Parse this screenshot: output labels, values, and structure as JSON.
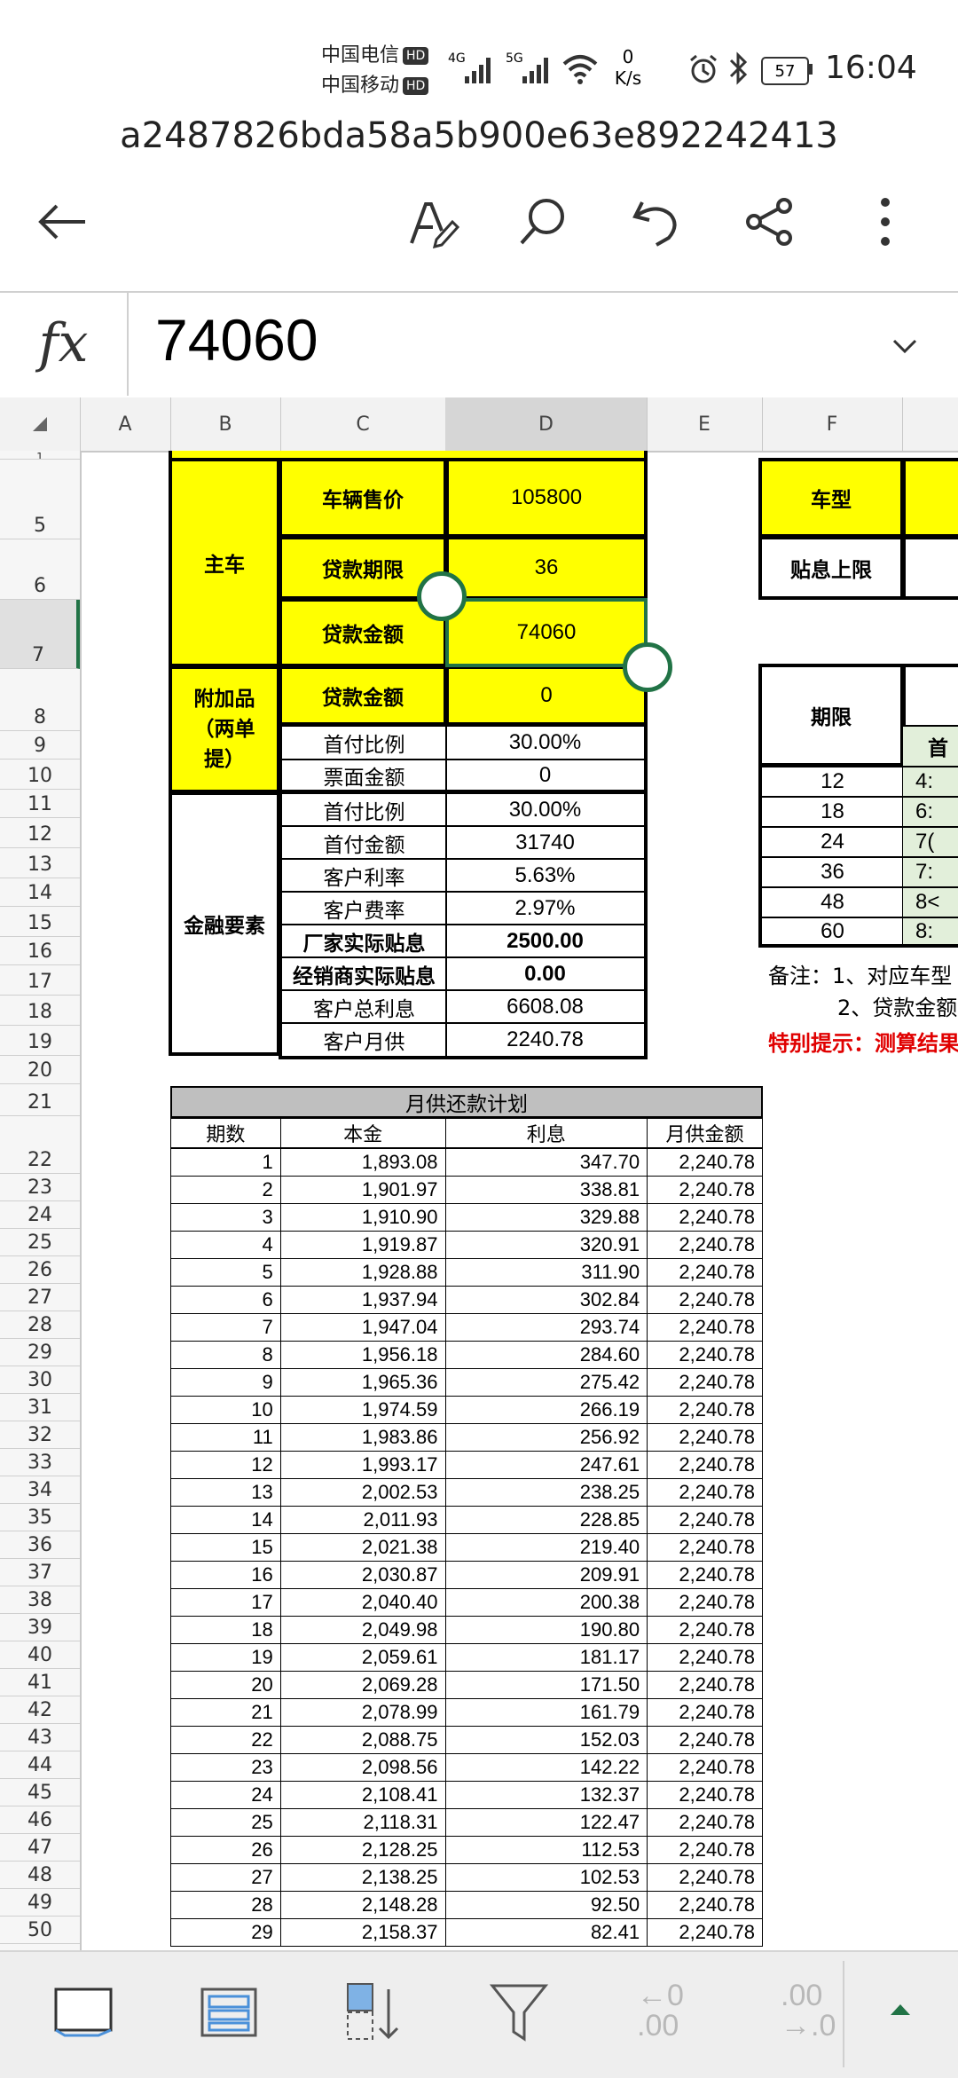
{
  "status_bar": {
    "carrier1": "中国电信",
    "carrier2": "中国移动",
    "hd": "HD",
    "net1": "4G",
    "net2": "5G",
    "speed_value": "0",
    "speed_unit": "K/s",
    "battery": "57",
    "time": "16:04"
  },
  "document_title": "a2487826bda58a5b900e63e892242413",
  "formula_bar": {
    "fx_label": "fx",
    "value": "74060"
  },
  "columns": [
    "A",
    "B",
    "C",
    "D",
    "E",
    "F"
  ],
  "rows": [
    "1",
    "5",
    "6",
    "7",
    "8",
    "9",
    "10",
    "11",
    "12",
    "13",
    "14",
    "15",
    "16",
    "17",
    "18",
    "19",
    "20",
    "21",
    "22",
    "23",
    "24",
    "25",
    "26",
    "27",
    "28",
    "29",
    "30",
    "31",
    "32",
    "33",
    "34",
    "35",
    "36",
    "37",
    "38",
    "39",
    "40",
    "41",
    "42",
    "43",
    "44",
    "45",
    "46",
    "47",
    "48",
    "49",
    "50"
  ],
  "main_table": {
    "main_car_label": "主车",
    "vehicle_price_label": "车辆售价",
    "vehicle_price": "105800",
    "loan_term_label": "贷款期限",
    "loan_term": "36",
    "loan_amount_label": "贷款金额",
    "loan_amount": "74060",
    "addon_label": "附加品（两单提）",
    "addon_loan_label": "贷款金额",
    "addon_loan": "0",
    "addon_down_label": "首付比例",
    "addon_down": "30.00%",
    "addon_ticket_label": "票面金额",
    "addon_ticket": "0",
    "finance_label": "金融要素",
    "down_ratio_label": "首付比例",
    "down_ratio": "30.00%",
    "down_amount_label": "首付金额",
    "down_amount": "31740",
    "rate_label": "客户利率",
    "rate": "5.63%",
    "fee_label": "客户费率",
    "fee": "2.97%",
    "mfr_subsidy_label": "厂家实际贴息",
    "mfr_subsidy": "2500.00",
    "dealer_subsidy_label": "经销商实际贴息",
    "dealer_subsidy": "0.00",
    "total_interest_label": "客户总利息",
    "total_interest": "6608.08",
    "monthly_label": "客户月供",
    "monthly": "2240.78"
  },
  "side_table": {
    "car_model_label": "车型",
    "subsidy_cap_label": "贴息上限",
    "term_label": "期限",
    "first_header_partial": "首",
    "terms": [
      "12",
      "18",
      "24",
      "36",
      "48",
      "60"
    ],
    "partial_values": [
      "4:",
      "6:",
      "7(",
      "7:",
      "8<",
      "8:"
    ],
    "note1": "备注：1、对应车型",
    "note2": "2、贷款金额",
    "special_note": "特别提示：测算结果"
  },
  "schedule": {
    "title": "月供还款计划",
    "headers": [
      "期数",
      "本金",
      "利息",
      "月供金额"
    ],
    "rows": [
      [
        "1",
        "1,893.08",
        "347.70",
        "2,240.78"
      ],
      [
        "2",
        "1,901.97",
        "338.81",
        "2,240.78"
      ],
      [
        "3",
        "1,910.90",
        "329.88",
        "2,240.78"
      ],
      [
        "4",
        "1,919.87",
        "320.91",
        "2,240.78"
      ],
      [
        "5",
        "1,928.88",
        "311.90",
        "2,240.78"
      ],
      [
        "6",
        "1,937.94",
        "302.84",
        "2,240.78"
      ],
      [
        "7",
        "1,947.04",
        "293.74",
        "2,240.78"
      ],
      [
        "8",
        "1,956.18",
        "284.60",
        "2,240.78"
      ],
      [
        "9",
        "1,965.36",
        "275.42",
        "2,240.78"
      ],
      [
        "10",
        "1,974.59",
        "266.19",
        "2,240.78"
      ],
      [
        "11",
        "1,983.86",
        "256.92",
        "2,240.78"
      ],
      [
        "12",
        "1,993.17",
        "247.61",
        "2,240.78"
      ],
      [
        "13",
        "2,002.53",
        "238.25",
        "2,240.78"
      ],
      [
        "14",
        "2,011.93",
        "228.85",
        "2,240.78"
      ],
      [
        "15",
        "2,021.38",
        "219.40",
        "2,240.78"
      ],
      [
        "16",
        "2,030.87",
        "209.91",
        "2,240.78"
      ],
      [
        "17",
        "2,040.40",
        "200.38",
        "2,240.78"
      ],
      [
        "18",
        "2,049.98",
        "190.80",
        "2,240.78"
      ],
      [
        "19",
        "2,059.61",
        "181.17",
        "2,240.78"
      ],
      [
        "20",
        "2,069.28",
        "171.50",
        "2,240.78"
      ],
      [
        "21",
        "2,078.99",
        "161.79",
        "2,240.78"
      ],
      [
        "22",
        "2,088.75",
        "152.03",
        "2,240.78"
      ],
      [
        "23",
        "2,098.56",
        "142.22",
        "2,240.78"
      ],
      [
        "24",
        "2,108.41",
        "132.37",
        "2,240.78"
      ],
      [
        "25",
        "2,118.31",
        "122.47",
        "2,240.78"
      ],
      [
        "26",
        "2,128.25",
        "112.53",
        "2,240.78"
      ],
      [
        "27",
        "2,138.25",
        "102.53",
        "2,240.78"
      ],
      [
        "28",
        "2,148.28",
        "92.50",
        "2,240.78"
      ],
      [
        "29",
        "2,158.37",
        "82.41",
        "2,240.78"
      ]
    ]
  },
  "bottom_bar": {
    "decrease_decimal": "←0 .00",
    "increase_decimal": ".00 →.0"
  },
  "colors": {
    "yellow": "#ffff00",
    "selection": "#217346",
    "special_red": "#e00000"
  }
}
